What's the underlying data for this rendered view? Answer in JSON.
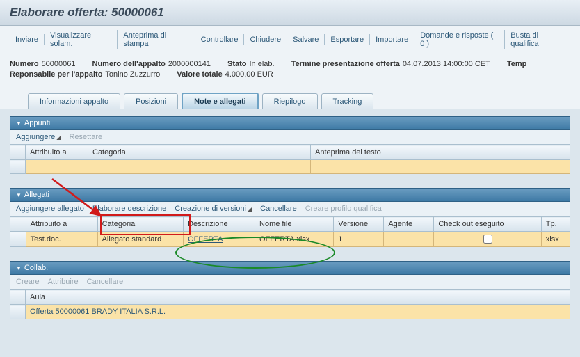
{
  "page_title": "Elaborare offerta: 50000061",
  "toolbar": {
    "inviare": "Inviare",
    "visualizzare": "Visualizzare solam.",
    "anteprima": "Anteprima di stampa",
    "controllare": "Controllare",
    "chiudere": "Chiudere",
    "salvare": "Salvare",
    "esportare": "Esportare",
    "importare": "Importare",
    "domande": "Domande e risposte ( 0 )",
    "busta": "Busta di qualifica"
  },
  "meta": {
    "numero_label": "Numero",
    "numero": "50000061",
    "appalto_label": "Numero dell'appalto",
    "appalto": "2000000141",
    "stato_label": "Stato",
    "stato": "In elab.",
    "termine_label": "Termine presentazione offerta",
    "termine": "04.07.2013 14:00:00 CET",
    "tempo_label": "Temp",
    "resp_label": "Reponsabile per l'appalto",
    "resp": "Tonino Zuzzurro",
    "valore_label": "Valore totale",
    "valore": "4.000,00 EUR"
  },
  "tabs": {
    "info": "Informazioni appalto",
    "posizioni": "Posizioni",
    "note": "Note e allegati",
    "riepilogo": "Riepilogo",
    "tracking": "Tracking"
  },
  "appunti": {
    "title": "Appunti",
    "aggiungere": "Aggiungere",
    "resettare": "Resettare",
    "col_attr": "Attribuito a",
    "col_cat": "Categoria",
    "col_ant": "Anteprima del testo"
  },
  "allegati": {
    "title": "Allegati",
    "aggiungere": "Aggiungere allegato",
    "elaborare": "Elaborare descrizione",
    "creazione": "Creazione di versioni",
    "cancellare": "Cancellare",
    "creare_profilo": "Creare profilo qualifica",
    "col_attr": "Attribuito a",
    "col_cat": "Categoria",
    "col_desc": "Descrizione",
    "col_nome": "Nome file",
    "col_ver": "Versione",
    "col_agente": "Agente",
    "col_checkout": "Check out eseguito",
    "col_tp": "Tp.",
    "row": {
      "attr": "Test.doc.",
      "cat": "Allegato standard",
      "desc": "OFFERTA",
      "nome": "OFFERTA.xlsx",
      "ver": "1",
      "tp": "xlsx"
    }
  },
  "collab": {
    "title": "Collab.",
    "creare": "Creare",
    "attribuire": "Attribuire",
    "cancellare": "Cancellare",
    "col_aula": "Aula",
    "row_link": "Offerta 50000061 BRADY ITALIA S.R.L."
  }
}
